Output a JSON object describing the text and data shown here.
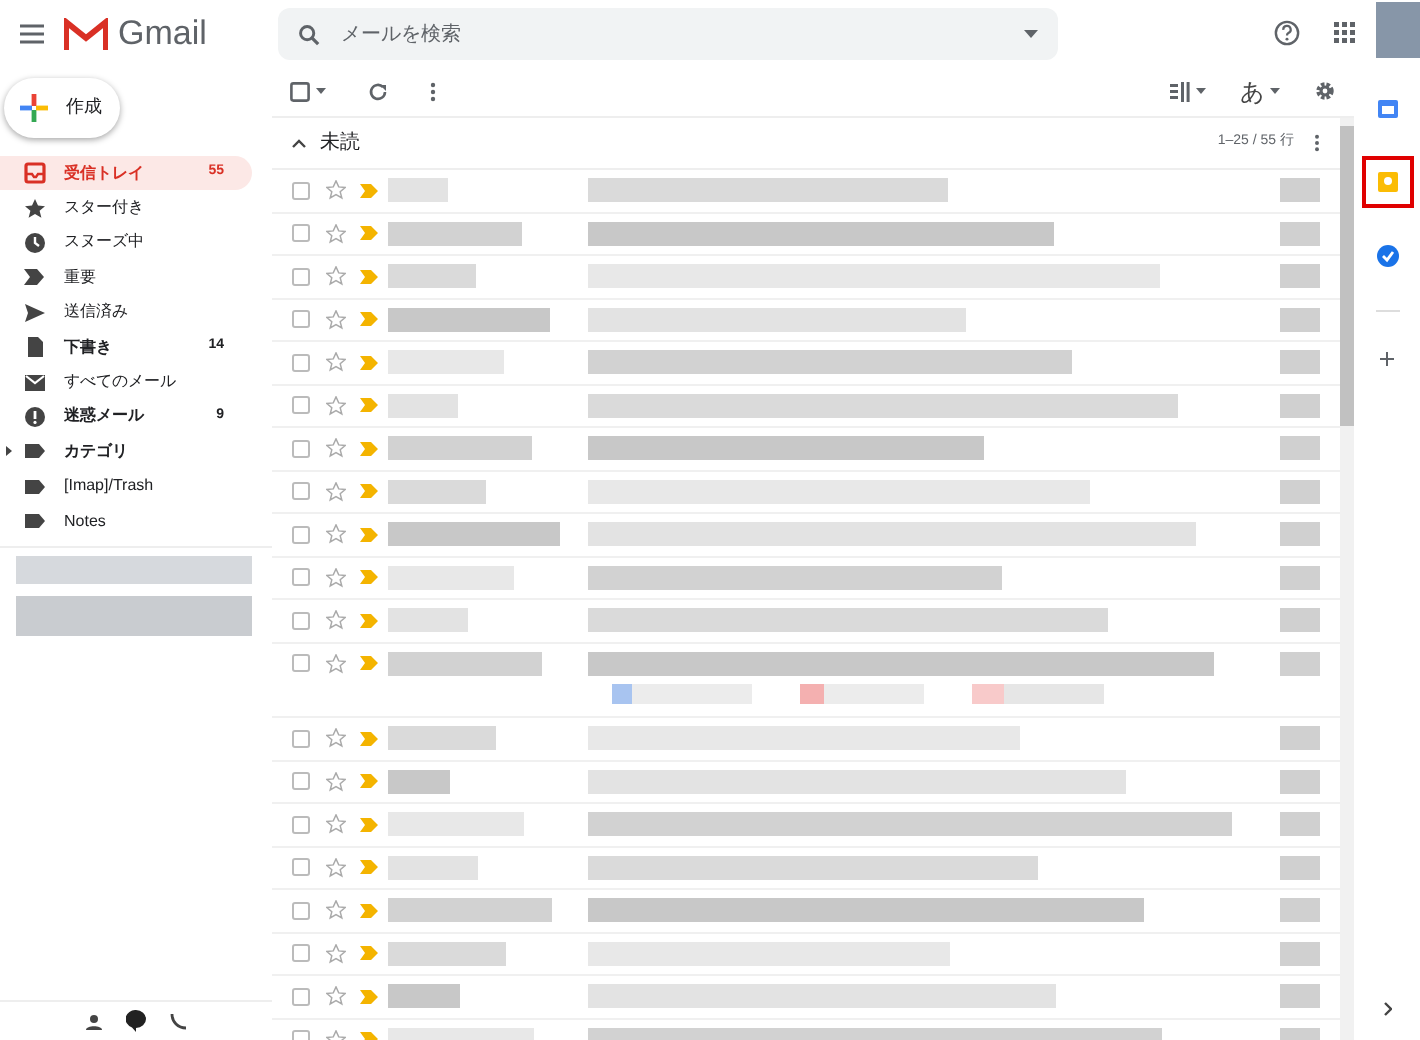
{
  "header": {
    "app_name": "Gmail",
    "search": {
      "placeholder": "メールを検索"
    }
  },
  "compose": {
    "label": "作成"
  },
  "sidebar": {
    "items": [
      {
        "kind": "inbox",
        "label": "受信トレイ",
        "count": "55",
        "selected": true,
        "bold": true,
        "expandable": false
      },
      {
        "kind": "star",
        "label": "スター付き",
        "selected": false,
        "bold": false,
        "expandable": false
      },
      {
        "kind": "snoozed",
        "label": "スヌーズ中",
        "selected": false,
        "bold": false,
        "expandable": false
      },
      {
        "kind": "important",
        "label": "重要",
        "selected": false,
        "bold": false,
        "expandable": false
      },
      {
        "kind": "sent",
        "label": "送信済み",
        "selected": false,
        "bold": false,
        "expandable": false
      },
      {
        "kind": "drafts",
        "label": "下書き",
        "count": "14",
        "selected": false,
        "bold": true,
        "expandable": false
      },
      {
        "kind": "all",
        "label": "すべてのメール",
        "selected": false,
        "bold": false,
        "expandable": false
      },
      {
        "kind": "spam",
        "label": "迷惑メール",
        "count": "9",
        "selected": false,
        "bold": true,
        "expandable": false
      },
      {
        "kind": "label",
        "label": "カテゴリ",
        "selected": false,
        "bold": true,
        "expandable": true
      },
      {
        "kind": "label",
        "label": "[Imap]/Trash",
        "selected": false,
        "bold": false,
        "expandable": false
      },
      {
        "kind": "label",
        "label": "Notes",
        "selected": false,
        "bold": false,
        "expandable": false
      }
    ]
  },
  "toolbar": {
    "view_button": "あ"
  },
  "section": {
    "title": "未読",
    "expanded": true,
    "range": "1–25 / 55 行"
  },
  "rows": [
    {
      "important": true,
      "attachments": false
    },
    {
      "important": true,
      "attachments": false
    },
    {
      "important": true,
      "attachments": false
    },
    {
      "important": true,
      "attachments": false
    },
    {
      "important": true,
      "attachments": false
    },
    {
      "important": true,
      "attachments": false
    },
    {
      "important": true,
      "attachments": false
    },
    {
      "important": true,
      "attachments": false
    },
    {
      "important": true,
      "attachments": false
    },
    {
      "important": true,
      "attachments": false
    },
    {
      "important": true,
      "attachments": false
    },
    {
      "important": true,
      "attachments": true
    },
    {
      "important": true,
      "attachments": false
    },
    {
      "important": true,
      "attachments": false
    },
    {
      "important": true,
      "attachments": false
    },
    {
      "important": true,
      "attachments": false
    },
    {
      "important": true,
      "attachments": false
    },
    {
      "important": true,
      "attachments": false
    },
    {
      "important": true,
      "attachments": false
    },
    {
      "important": true,
      "attachments": false
    }
  ],
  "right_rail": {
    "items": [
      {
        "kind": "calendar",
        "highlighted": false
      },
      {
        "kind": "notes",
        "highlighted": true
      },
      {
        "kind": "tasks",
        "highlighted": false
      }
    ]
  }
}
